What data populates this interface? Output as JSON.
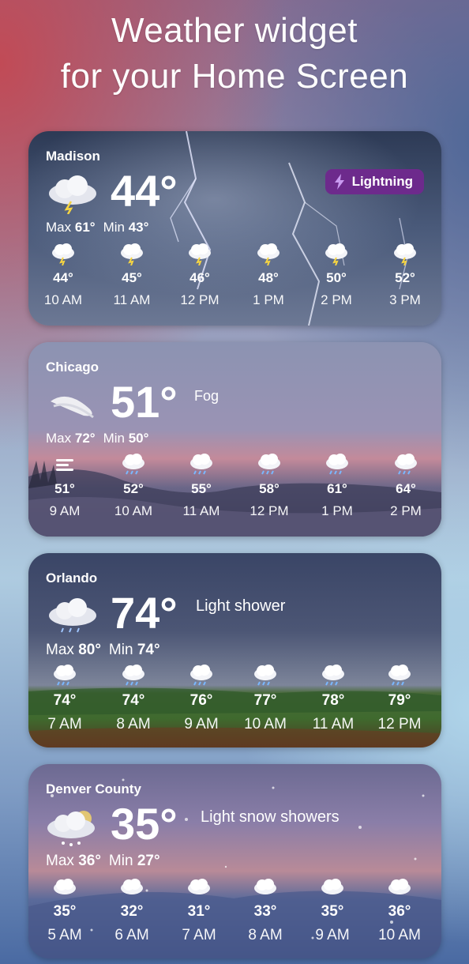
{
  "headline": {
    "line1": "Weather widget",
    "line2": "for your Home Screen"
  },
  "cards": [
    {
      "city": "Madison",
      "temp": "44°",
      "condition": "",
      "badge": "Lightning",
      "icon": "thunder-cloud-icon",
      "max_label": "Max",
      "max": "61°",
      "min_label": "Min",
      "min": "43°",
      "hours": [
        {
          "time": "10 AM",
          "temp": "44°",
          "icon": "thunderstorm-icon"
        },
        {
          "time": "11 AM",
          "temp": "45°",
          "icon": "thunderstorm-icon"
        },
        {
          "time": "12 PM",
          "temp": "46°",
          "icon": "thunderstorm-icon"
        },
        {
          "time": "1 PM",
          "temp": "48°",
          "icon": "thunderstorm-icon"
        },
        {
          "time": "2 PM",
          "temp": "50°",
          "icon": "thunderstorm-icon"
        },
        {
          "time": "3 PM",
          "temp": "52°",
          "icon": "thunderstorm-icon"
        }
      ]
    },
    {
      "city": "Chicago",
      "temp": "51°",
      "condition": "Fog",
      "icon": "fog-icon",
      "max_label": "Max",
      "max": "72°",
      "min_label": "Min",
      "min": "50°",
      "hours": [
        {
          "time": "9 AM",
          "temp": "51°",
          "icon": "fog-lines-icon"
        },
        {
          "time": "10 AM",
          "temp": "52°",
          "icon": "rain-thunder-icon"
        },
        {
          "time": "11 AM",
          "temp": "55°",
          "icon": "rain-thunder-icon"
        },
        {
          "time": "12 PM",
          "temp": "58°",
          "icon": "rain-thunder-icon"
        },
        {
          "time": "1 PM",
          "temp": "61°",
          "icon": "rain-thunder-icon"
        },
        {
          "time": "2 PM",
          "temp": "64°",
          "icon": "rain-thunder-icon"
        }
      ]
    },
    {
      "city": "Orlando",
      "temp": "74°",
      "condition": "Light shower",
      "icon": "rain-cloud-icon",
      "max_label": "Max",
      "max": "80°",
      "min_label": "Min",
      "min": "74°",
      "hours": [
        {
          "time": "7 AM",
          "temp": "74°",
          "icon": "rain-icon"
        },
        {
          "time": "8 AM",
          "temp": "74°",
          "icon": "rain-icon"
        },
        {
          "time": "9 AM",
          "temp": "76°",
          "icon": "rain-icon"
        },
        {
          "time": "10 AM",
          "temp": "77°",
          "icon": "rain-icon"
        },
        {
          "time": "11 AM",
          "temp": "78°",
          "icon": "rain-icon"
        },
        {
          "time": "12 PM",
          "temp": "79°",
          "icon": "rain-icon"
        }
      ]
    },
    {
      "city": "Denver County",
      "temp": "35°",
      "condition": "Light snow showers",
      "icon": "snow-cloud-icon",
      "max_label": "Max",
      "max": "36°",
      "min_label": "Min",
      "min": "27°",
      "hours": [
        {
          "time": "5 AM",
          "temp": "35°",
          "icon": "cloud-icon"
        },
        {
          "time": "6 AM",
          "temp": "32°",
          "icon": "cloud-icon"
        },
        {
          "time": "7 AM",
          "temp": "31°",
          "icon": "cloud-icon"
        },
        {
          "time": "8 AM",
          "temp": "33°",
          "icon": "cloud-icon"
        },
        {
          "time": "9 AM",
          "temp": "35°",
          "icon": "cloud-icon"
        },
        {
          "time": "10 AM",
          "temp": "36°",
          "icon": "cloud-icon"
        }
      ]
    }
  ],
  "colors": {
    "badge": "#6d2a8c",
    "text": "#ffffff"
  }
}
